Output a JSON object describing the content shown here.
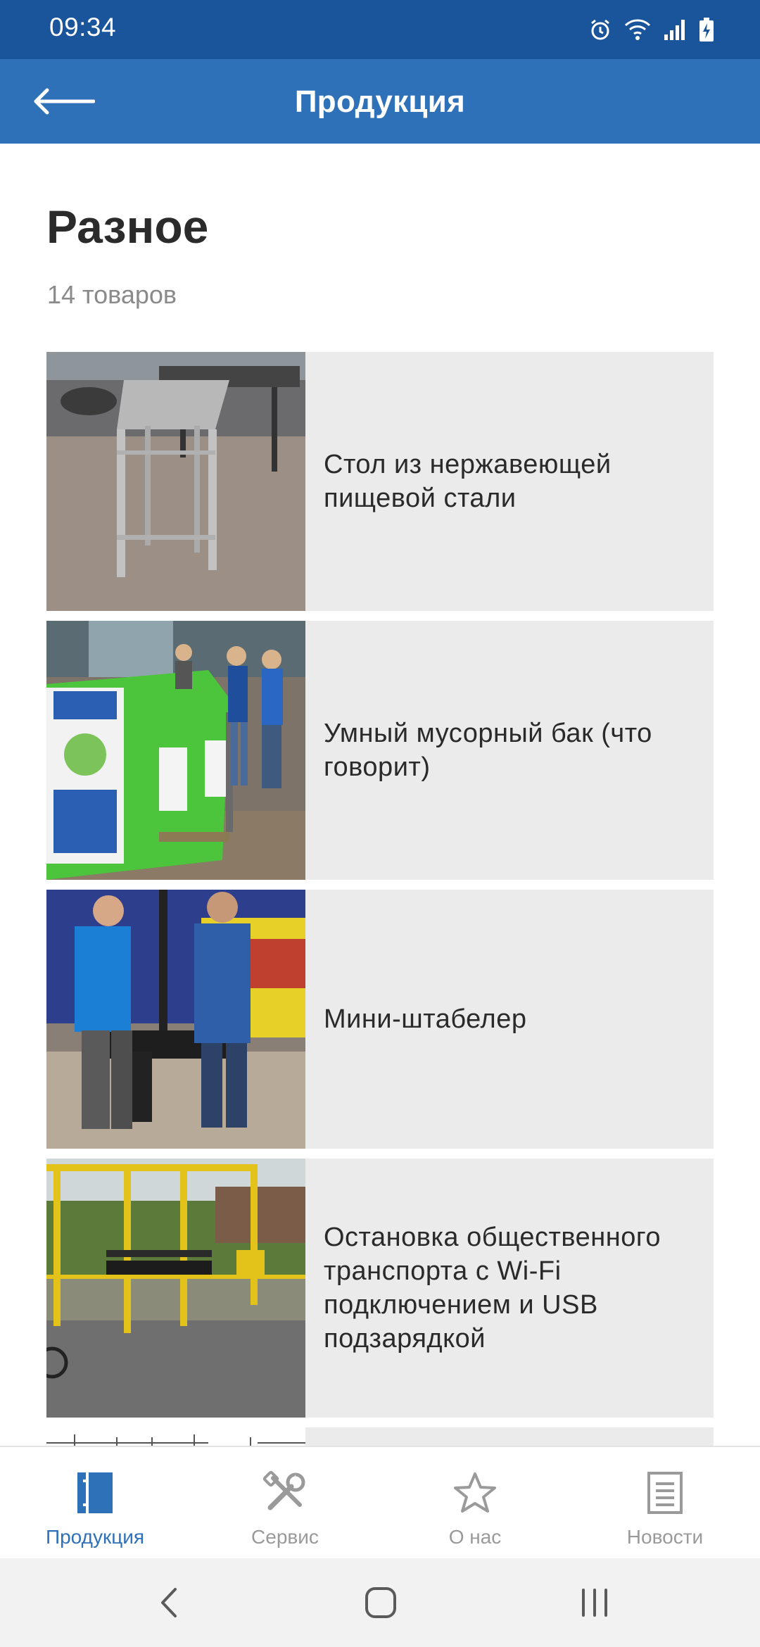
{
  "status_bar": {
    "time": "09:34",
    "icons": [
      "alarm-icon",
      "wifi-icon",
      "signal-icon",
      "battery-charging-icon"
    ]
  },
  "app_bar": {
    "title": "Продукция",
    "back_icon": "arrow-left-icon"
  },
  "category": {
    "title": "Разное",
    "count": "14 товаров"
  },
  "products": [
    {
      "title": "Стол из нержавеющей пищевой стали",
      "image": "stainless-steel-table-photo"
    },
    {
      "title": "Умный мусорный бак (что говорит)",
      "image": "smart-trash-bin-photo"
    },
    {
      "title": "Мини-штабелер",
      "image": "mini-stacker-photo"
    },
    {
      "title": "Остановка общественного транспорта с Wi-Fi подключением и USB подзарядкой",
      "image": "bus-stop-photo"
    }
  ],
  "bottom_nav": {
    "items": [
      {
        "label": "Продукция",
        "icon": "catalog-icon",
        "active": true
      },
      {
        "label": "Сервис",
        "icon": "tools-icon",
        "active": false
      },
      {
        "label": "О нас",
        "icon": "star-icon",
        "active": false
      },
      {
        "label": "Новости",
        "icon": "news-icon",
        "active": false
      }
    ]
  },
  "system_nav": [
    "back-icon",
    "home-icon",
    "recents-icon"
  ],
  "colors": {
    "status_bar": "#1a559c",
    "app_bar": "#2f71b8",
    "card_bg": "#ebebeb",
    "accent": "#2f71b8",
    "inactive": "#9a9a9a"
  }
}
